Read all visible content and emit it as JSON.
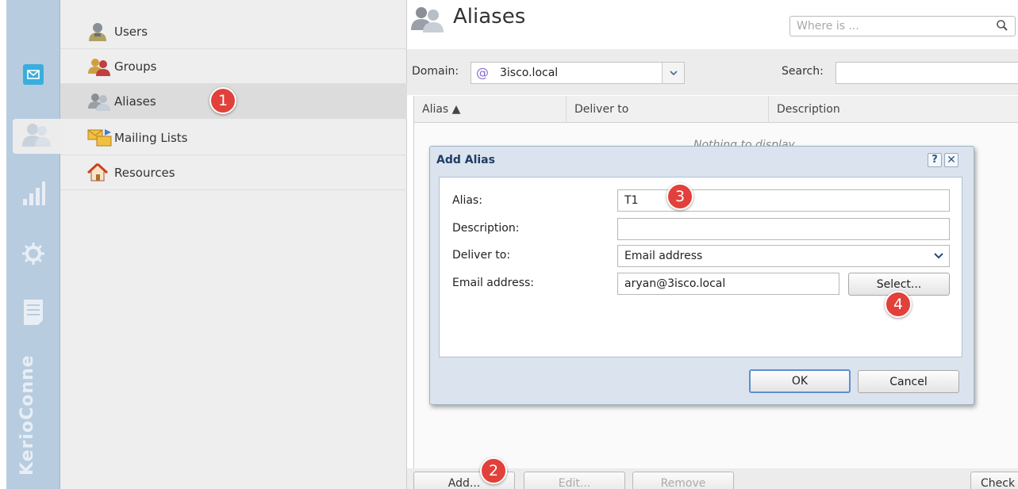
{
  "rail": {
    "brand": "KerioConne",
    "items": [
      "mail-icon",
      "users-icon",
      "statistics-icon",
      "settings-icon",
      "logs-icon"
    ]
  },
  "nav": {
    "items": [
      {
        "label": "Users",
        "icon": "user-icon"
      },
      {
        "label": "Groups",
        "icon": "groups-icon"
      },
      {
        "label": "Aliases",
        "icon": "aliases-icon",
        "selected": true
      },
      {
        "label": "Mailing Lists",
        "icon": "mailing-lists-icon"
      },
      {
        "label": "Resources",
        "icon": "resources-icon"
      }
    ]
  },
  "header": {
    "title": "Aliases",
    "where_placeholder": "Where is ..."
  },
  "filter": {
    "domain_label": "Domain:",
    "domain_value": "3isco.local",
    "search_label": "Search:"
  },
  "grid": {
    "columns": [
      "Alias ▲",
      "Deliver to",
      "Description"
    ],
    "empty_text": "Nothing to display"
  },
  "bottom": {
    "add": "Add...",
    "edit": "Edit...",
    "remove": "Remove",
    "check": "Check"
  },
  "dialog": {
    "title": "Add Alias",
    "help": "?",
    "close": "✕",
    "fields": {
      "alias_label": "Alias:",
      "alias_value": "T1",
      "description_label": "Description:",
      "description_value": "",
      "deliver_label": "Deliver to:",
      "deliver_value": "Email address",
      "email_label": "Email address:",
      "email_value": "aryan@3isco.local"
    },
    "select_button": "Select...",
    "ok_button": "OK",
    "cancel_button": "Cancel"
  },
  "markers": [
    "1",
    "2",
    "3",
    "4"
  ],
  "colors": {
    "rail": "#b8cce0",
    "accent": "#3aaedd",
    "marker": "#e2403a",
    "dialog_title": "#1e3c66"
  }
}
